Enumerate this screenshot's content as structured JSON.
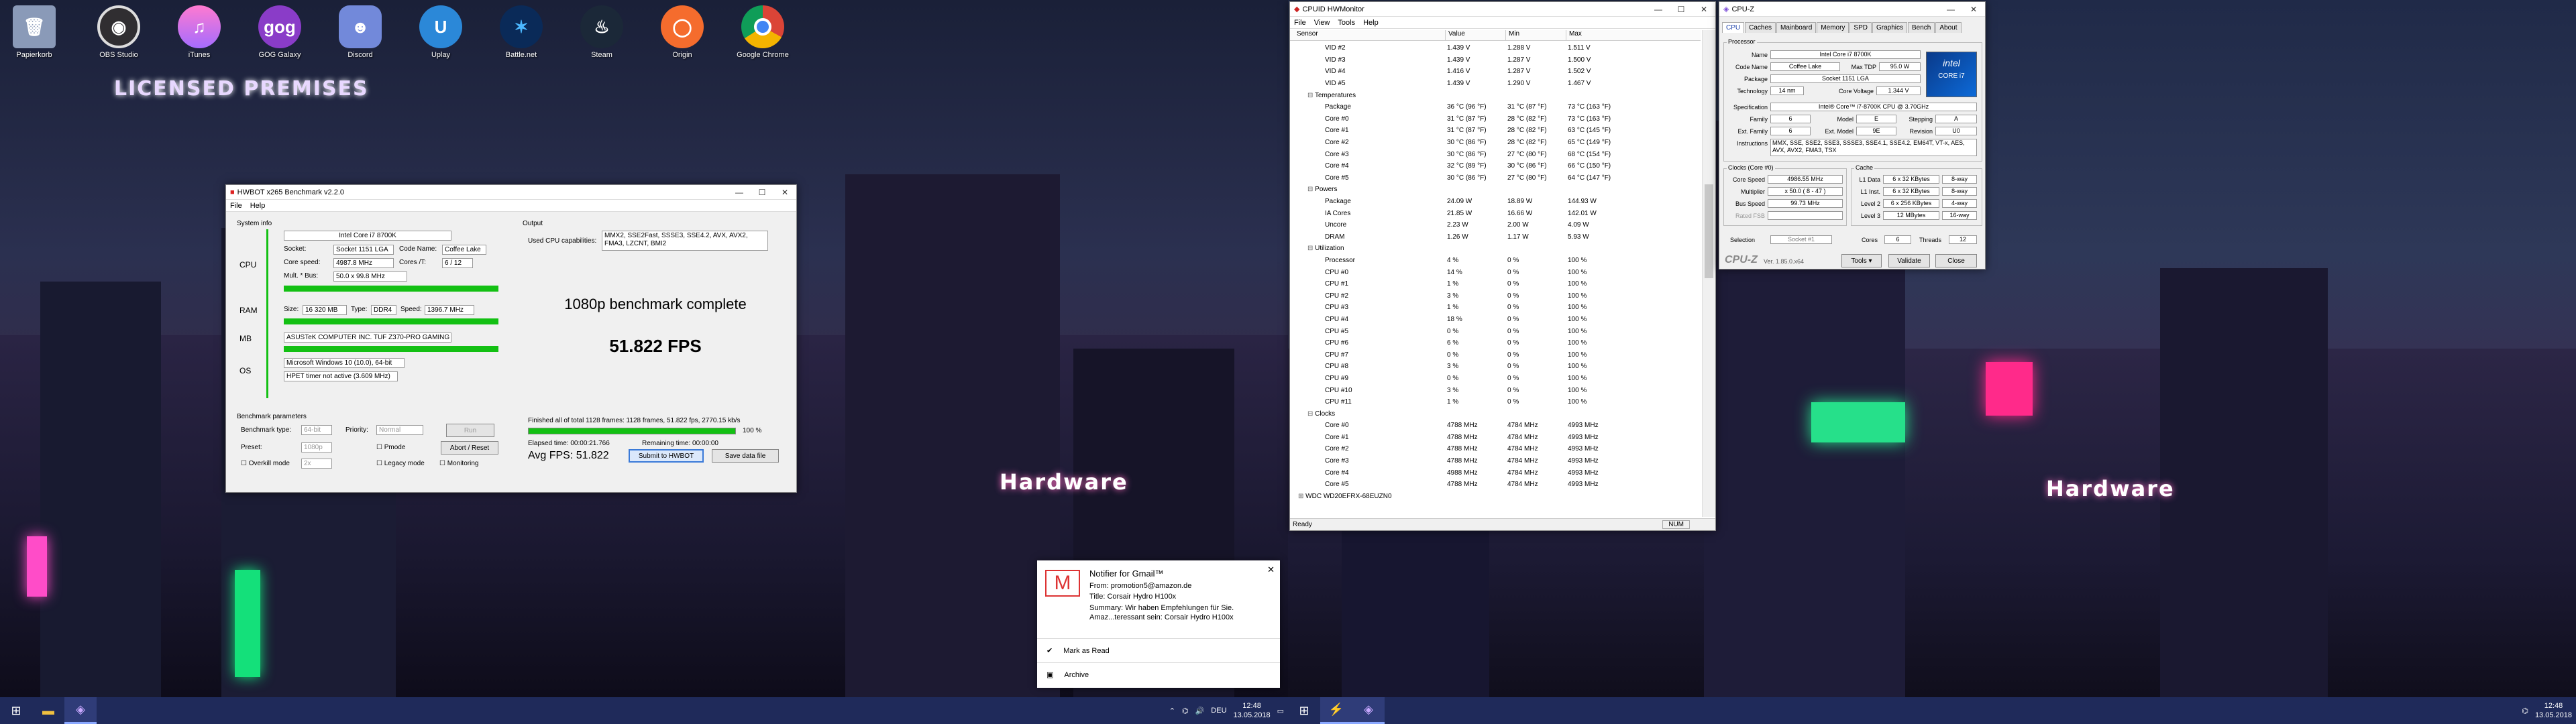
{
  "desktop_icons": [
    "Papierkorb",
    "OBS Studio",
    "iTunes",
    "GOG Galaxy",
    "Discord",
    "Uplay",
    "Battle.net",
    "Steam",
    "Origin",
    "Google Chrome"
  ],
  "wallpaper_signs": [
    "LICENSED PREMISES",
    "Hardware",
    "Hardware"
  ],
  "hwbot": {
    "title": "HWBOT x265 Benchmark v2.2.0",
    "menu": [
      "File",
      "Help"
    ],
    "system_info": "System info",
    "output": "Output",
    "cpu_label": "CPU",
    "ram_label": "RAM",
    "mb_label": "MB",
    "os_label": "OS",
    "cpu_name": "Intel Core i7 8700K",
    "socket_lbl": "Socket:",
    "socket": "Socket 1151 LGA",
    "codename_lbl": "Code Name:",
    "codename": "Coffee Lake",
    "speed_lbl": "Core speed:",
    "speed": "4987.8 MHz",
    "cores_lbl": "Cores /T:",
    "cores": "6 / 12",
    "mult_lbl": "Mult. * Bus:",
    "mult": "50.0 x 99.8 MHz",
    "size_lbl": "Size:",
    "size": "16 320 MB",
    "type_lbl": "Type:",
    "type": "DDR4",
    "ramspeed_lbl": "Speed:",
    "ramspeed": "1396.7 MHz",
    "mb": "ASUSTeK COMPUTER INC. TUF Z370-PRO GAMING",
    "os": "Microsoft Windows 10 (10.0), 64-bit",
    "timer": "HPET timer not active (3.609 MHz)",
    "caps_lbl": "Used CPU capabilities:",
    "caps": "MMX2, SSE2Fast, SSSE3, SSE4.2, AVX, AVX2, FMA3, LZCNT, BMI2",
    "complete": "1080p benchmark complete",
    "fps": "51.822 FPS",
    "bench_params": "Benchmark parameters",
    "bench_type_lbl": "Benchmark type:",
    "bench_type": "64-bit",
    "priority_lbl": "Priority:",
    "priority": "Normal",
    "run": "Run",
    "preset_lbl": "Preset:",
    "preset": "1080p",
    "pmode": "Pmode",
    "abort": "Abort / Reset",
    "overkill": "Overkill mode",
    "overkill_val": "2x",
    "legacy": "Legacy mode",
    "monitoring": "Monitoring",
    "finished": "Finished all of total 1128 frames: 1128 frames, 51.822 fps, 2770.15 kb/s",
    "progress": 100,
    "progress_txt": "100 %",
    "elapsed": "Elapsed time: 00:00:21.766",
    "remaining": "Remaining time: 00:00:00",
    "avg": "Avg FPS: 51.822",
    "submit": "Submit to HWBOT",
    "save": "Save data file"
  },
  "hwmon": {
    "title": "CPUID HWMonitor",
    "menu": [
      "File",
      "View",
      "Tools",
      "Help"
    ],
    "cols": [
      "Sensor",
      "Value",
      "Min",
      "Max"
    ],
    "rows": [
      [
        "2",
        "VID #2",
        "1.439 V",
        "1.288 V",
        "1.511 V"
      ],
      [
        "2",
        "VID #3",
        "1.439 V",
        "1.287 V",
        "1.500 V"
      ],
      [
        "2",
        "VID #4",
        "1.416 V",
        "1.287 V",
        "1.502 V"
      ],
      [
        "2",
        "VID #5",
        "1.439 V",
        "1.290 V",
        "1.467 V"
      ],
      [
        "1",
        "Temperatures",
        "",
        "",
        ""
      ],
      [
        "2",
        "Package",
        "36 °C (96 °F)",
        "31 °C (87 °F)",
        "73 °C (163 °F)"
      ],
      [
        "2",
        "Core #0",
        "31 °C (87 °F)",
        "28 °C (82 °F)",
        "73 °C (163 °F)"
      ],
      [
        "2",
        "Core #1",
        "31 °C (87 °F)",
        "28 °C (82 °F)",
        "63 °C (145 °F)"
      ],
      [
        "2",
        "Core #2",
        "30 °C (86 °F)",
        "28 °C (82 °F)",
        "65 °C (149 °F)"
      ],
      [
        "2",
        "Core #3",
        "30 °C (86 °F)",
        "27 °C (80 °F)",
        "68 °C (154 °F)"
      ],
      [
        "2",
        "Core #4",
        "32 °C (89 °F)",
        "30 °C (86 °F)",
        "66 °C (150 °F)"
      ],
      [
        "2",
        "Core #5",
        "30 °C (86 °F)",
        "27 °C (80 °F)",
        "64 °C (147 °F)"
      ],
      [
        "1",
        "Powers",
        "",
        "",
        ""
      ],
      [
        "2",
        "Package",
        "24.09 W",
        "18.89 W",
        "144.93 W"
      ],
      [
        "2",
        "IA Cores",
        "21.85 W",
        "16.66 W",
        "142.01 W"
      ],
      [
        "2",
        "Uncore",
        "2.23 W",
        "2.00 W",
        "4.09 W"
      ],
      [
        "2",
        "DRAM",
        "1.26 W",
        "1.17 W",
        "5.93 W"
      ],
      [
        "1",
        "Utilization",
        "",
        "",
        ""
      ],
      [
        "2",
        "Processor",
        "4 %",
        "0 %",
        "100 %"
      ],
      [
        "2",
        "CPU #0",
        "14 %",
        "0 %",
        "100 %"
      ],
      [
        "2",
        "CPU #1",
        "1 %",
        "0 %",
        "100 %"
      ],
      [
        "2",
        "CPU #2",
        "3 %",
        "0 %",
        "100 %"
      ],
      [
        "2",
        "CPU #3",
        "1 %",
        "0 %",
        "100 %"
      ],
      [
        "2",
        "CPU #4",
        "18 %",
        "0 %",
        "100 %"
      ],
      [
        "2",
        "CPU #5",
        "0 %",
        "0 %",
        "100 %"
      ],
      [
        "2",
        "CPU #6",
        "6 %",
        "0 %",
        "100 %"
      ],
      [
        "2",
        "CPU #7",
        "0 %",
        "0 %",
        "100 %"
      ],
      [
        "2",
        "CPU #8",
        "3 %",
        "0 %",
        "100 %"
      ],
      [
        "2",
        "CPU #9",
        "0 %",
        "0 %",
        "100 %"
      ],
      [
        "2",
        "CPU #10",
        "3 %",
        "0 %",
        "100 %"
      ],
      [
        "2",
        "CPU #11",
        "1 %",
        "0 %",
        "100 %"
      ],
      [
        "1",
        "Clocks",
        "",
        "",
        ""
      ],
      [
        "2",
        "Core #0",
        "4788 MHz",
        "4784 MHz",
        "4993 MHz"
      ],
      [
        "2",
        "Core #1",
        "4788 MHz",
        "4784 MHz",
        "4993 MHz"
      ],
      [
        "2",
        "Core #2",
        "4788 MHz",
        "4784 MHz",
        "4993 MHz"
      ],
      [
        "2",
        "Core #3",
        "4788 MHz",
        "4784 MHz",
        "4993 MHz"
      ],
      [
        "2",
        "Core #4",
        "4988 MHz",
        "4784 MHz",
        "4993 MHz"
      ],
      [
        "2",
        "Core #5",
        "4788 MHz",
        "4784 MHz",
        "4993 MHz"
      ],
      [
        "0",
        "WDC WD20EFRX-68EUZN0",
        "",
        "",
        ""
      ]
    ],
    "status": "Ready",
    "num": "NUM"
  },
  "cpuz": {
    "title": "CPU-Z",
    "tabs": [
      "CPU",
      "Caches",
      "Mainboard",
      "Memory",
      "SPD",
      "Graphics",
      "Bench",
      "About"
    ],
    "processor": "Processor",
    "name_lbl": "Name",
    "name": "Intel Core i7 8700K",
    "codename_lbl": "Code Name",
    "codename": "Coffee Lake",
    "tdp_lbl": "Max TDP",
    "tdp": "95.0 W",
    "package_lbl": "Package",
    "package": "Socket 1151 LGA",
    "tech_lbl": "Technology",
    "tech": "14 nm",
    "voltage_lbl": "Core Voltage",
    "voltage": "1.344 V",
    "spec_lbl": "Specification",
    "spec": "Intel® Core™ i7-8700K CPU @ 3.70GHz",
    "family_lbl": "Family",
    "family": "6",
    "model_lbl": "Model",
    "model": "E",
    "stepping_lbl": "Stepping",
    "stepping": "A",
    "extfam_lbl": "Ext. Family",
    "extfam": "6",
    "extmodel_lbl": "Ext. Model",
    "extmodel": "9E",
    "rev_lbl": "Revision",
    "rev": "U0",
    "instr_lbl": "Instructions",
    "instr": "MMX, SSE, SSE2, SSE3, SSSE3, SSE4.1, SSE4.2, EM64T, VT-x, AES, AVX, AVX2, FMA3, TSX",
    "clocks": "Clocks (Core #0)",
    "cache": "Cache",
    "corespeed_lbl": "Core Speed",
    "corespeed": "4986.55 MHz",
    "mult_lbl": "Multiplier",
    "mult": "x 50.0 ( 8 - 47 )",
    "bus_lbl": "Bus Speed",
    "bus": "99.73 MHz",
    "fsb_lbl": "Rated FSB",
    "l1d_lbl": "L1 Data",
    "l1d": "6 x 32 KBytes",
    "l1d_w": "8-way",
    "l1i_lbl": "L1 Inst.",
    "l1i": "6 x 32 KBytes",
    "l1i_w": "8-way",
    "l2_lbl": "Level 2",
    "l2": "6 x 256 KBytes",
    "l2_w": "4-way",
    "l3_lbl": "Level 3",
    "l3": "12 MBytes",
    "l3_w": "16-way",
    "sel_lbl": "Selection",
    "sel": "Socket #1",
    "cores_lbl": "Cores",
    "cores": "6",
    "threads_lbl": "Threads",
    "threads": "12",
    "logo": "CPU-Z",
    "ver": "Ver. 1.85.0.x64",
    "tools": "Tools",
    "validate": "Validate",
    "close": "Close",
    "badge_brand": "intel",
    "badge_core": "CORE i7"
  },
  "notif": {
    "title": "Notifier for Gmail™",
    "from": "From: promotion5@amazon.de",
    "titleline": "Title: Corsair Hydro H100x",
    "summary": "Summary: Wir haben Empfehlungen für Sie. Amaz...teressant sein: Corsair Hydro H100x",
    "mark": "Mark as Read",
    "archive": "Archive"
  },
  "taskbar": {
    "time": "12:48",
    "date": "13.05.2018",
    "time2": "12:48",
    "date2": "13.05.2018",
    "lang": "DEU"
  }
}
